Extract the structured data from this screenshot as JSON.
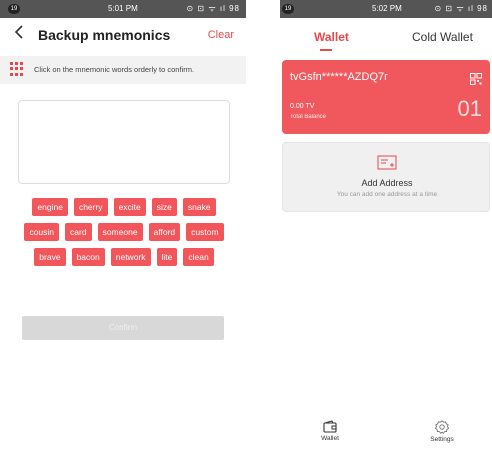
{
  "left_screen": {
    "status_bar": {
      "badge": "19",
      "time": "5:01 PM",
      "icons": "⊙ ⊡ ᯤ ıl 98"
    },
    "header": {
      "back_icon": "chevron-left-icon",
      "title": "Backup mnemonics",
      "clear_label": "Clear"
    },
    "hint": {
      "icon": "grid-icon",
      "text": "Click on the mnemonic words orderly to confirm."
    },
    "answer_box": {
      "value": ""
    },
    "word_rows": [
      [
        "engine",
        "cherry",
        "excite",
        "size",
        "snake"
      ],
      [
        "cousin",
        "card",
        "someone",
        "afford",
        "custom"
      ],
      [
        "brave",
        "bacon",
        "network",
        "lite",
        "clean"
      ]
    ],
    "confirm_label": "Confirm",
    "colors": {
      "accent": "#e9484b",
      "chip": "#f2555a",
      "disabled": "#d8d8d8"
    }
  },
  "right_screen": {
    "status_bar": {
      "badge": "19",
      "time": "5:02 PM",
      "icons": "⊙ ⊡ ᯤ ıl 98"
    },
    "tabs": [
      {
        "label": "Wallet",
        "active": true
      },
      {
        "label": "Cold Wallet",
        "active": false
      }
    ],
    "wallet_card": {
      "address": "tvGsfn******AZDQ7r",
      "balance": "0.00 TV",
      "balance_label": "Total Balance",
      "index": "01",
      "qr_icon": "qr-code-icon"
    },
    "add_address": {
      "icon": "address-card-icon",
      "title": "Add Address",
      "subtitle": "You can add one address at a time"
    },
    "bottom_nav": [
      {
        "label": "Wallet",
        "icon": "wallet-icon"
      },
      {
        "label": "Settings",
        "icon": "gear-icon"
      }
    ]
  }
}
